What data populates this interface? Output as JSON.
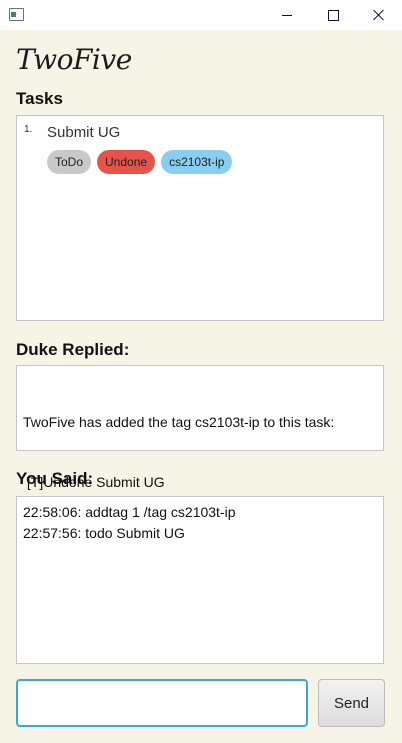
{
  "window": {
    "icon": "app-window-icon",
    "controls": [
      "minimize-icon",
      "maximize-icon",
      "close-icon"
    ]
  },
  "app_title": "TwoFive",
  "tasks_section": {
    "label": "Tasks",
    "items": [
      {
        "index": "1.",
        "description": "Submit UG",
        "tags": [
          {
            "label": "ToDo",
            "color": "#c9c9c9"
          },
          {
            "label": "Undone",
            "color": "#e5534b"
          },
          {
            "label": "cs2103t-ip",
            "color": "#87cef0"
          }
        ]
      }
    ]
  },
  "duke_section": {
    "label": "Duke Replied:",
    "reply_lines": [
      "TwoFive has added the tag cs2103t-ip to this task:",
      " [T]Undone Submit UG"
    ]
  },
  "you_section": {
    "label": "You Said:",
    "lines": [
      "22:58:06: addtag 1 /tag cs2103t-ip",
      "22:57:56: todo Submit UG"
    ]
  },
  "input": {
    "value": "",
    "placeholder": "",
    "focus_color": "#38a8dc"
  },
  "send_button": {
    "label": "Send"
  }
}
